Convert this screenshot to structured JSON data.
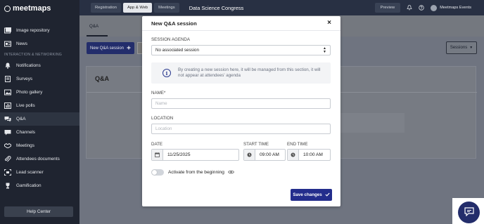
{
  "app": {
    "logo_text": "meetmaps"
  },
  "topbar": {
    "nav": [
      "Registration",
      "App & Web",
      "Meetings"
    ],
    "active_nav": "App & Web",
    "event_name": "Data Science Congress",
    "preview_label": "Preview",
    "user_name": "Meetmaps Events"
  },
  "sidebar": {
    "items_top": [
      {
        "label": "Image repository",
        "icon": "image-icon"
      },
      {
        "label": "News",
        "icon": "news-icon"
      }
    ],
    "section_label": "INTERACTION & NETWORKING",
    "items": [
      {
        "label": "Notifications",
        "icon": "bell-icon"
      },
      {
        "label": "Surveys",
        "icon": "survey-icon"
      },
      {
        "label": "Photo gallery",
        "icon": "gallery-icon"
      },
      {
        "label": "Live polls",
        "icon": "poll-icon"
      },
      {
        "label": "Q&A",
        "icon": "qa-icon",
        "active": true
      },
      {
        "label": "Channels",
        "icon": "channel-icon"
      },
      {
        "label": "Meetings",
        "icon": "handshake-icon"
      },
      {
        "label": "Attendees documents",
        "icon": "paperclip-icon"
      },
      {
        "label": "Lead scanner",
        "icon": "scanner-icon"
      },
      {
        "label": "Gamification",
        "icon": "trophy-icon"
      }
    ],
    "help_label": "Help Center"
  },
  "page": {
    "tab": "Q&A",
    "new_session_label": "New Q&A session",
    "sessions_label": "Sessions",
    "panel_title": "Q&A"
  },
  "modal": {
    "title": "New Q&A session",
    "session_agenda_label": "SESSION AGENDA",
    "session_agenda_value": "No associated session",
    "info_text": "By creating a new session here, it will be managed from this section, it will not appear at attendees' agenda",
    "name_label": "NAME*",
    "name_placeholder": "Name",
    "location_label": "LOCATION",
    "location_placeholder": "Location",
    "date_label": "DATE",
    "date_value": "11/25/2025",
    "start_time_label": "START TIME",
    "start_time_value": "09:00 AM",
    "end_time_label": "END TIME",
    "end_time_value": "10:00 AM",
    "toggle_label": "Activate from the beginning",
    "toggle_on": false,
    "save_label": "Save changes"
  },
  "colors": {
    "primary": "#232d8c",
    "sidebar": "#1f2430",
    "topbar": "#283043"
  }
}
